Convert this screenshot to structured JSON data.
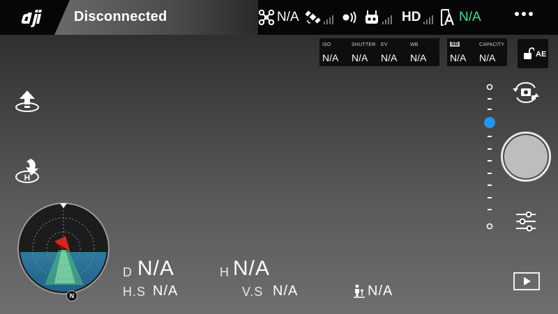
{
  "topbar": {
    "connection_status": "Disconnected",
    "aircraft_value": "N/A",
    "hd_label": "HD",
    "battery_value": "N/A",
    "colors": {
      "battery_value": "#2ee69a",
      "background": "#060606"
    }
  },
  "camera": {
    "iso": {
      "label": "ISO",
      "value": "N/A"
    },
    "shutter": {
      "label": "SHUTTER",
      "value": "N/A"
    },
    "ev": {
      "label": "EV",
      "value": "N/A"
    },
    "wb": {
      "label": "WB",
      "value": "N/A"
    },
    "sd": {
      "label": "SD",
      "value": "N/A"
    },
    "capacity": {
      "label": "CAPACITY",
      "value": "N/A"
    },
    "ae_label": "AE"
  },
  "radar": {
    "north_label": "N"
  },
  "telemetry": {
    "distance": {
      "label": "D",
      "value": "N/A"
    },
    "height": {
      "label": "H",
      "value": "N/A"
    },
    "hspeed": {
      "label": "H.S",
      "value": "N/A"
    },
    "vspeed": {
      "label": "V.S",
      "value": "N/A"
    },
    "vps": {
      "value": "N/A"
    }
  },
  "colors": {
    "slider_thumb": "#2196f3",
    "radar_water": "#2f7aa0"
  }
}
